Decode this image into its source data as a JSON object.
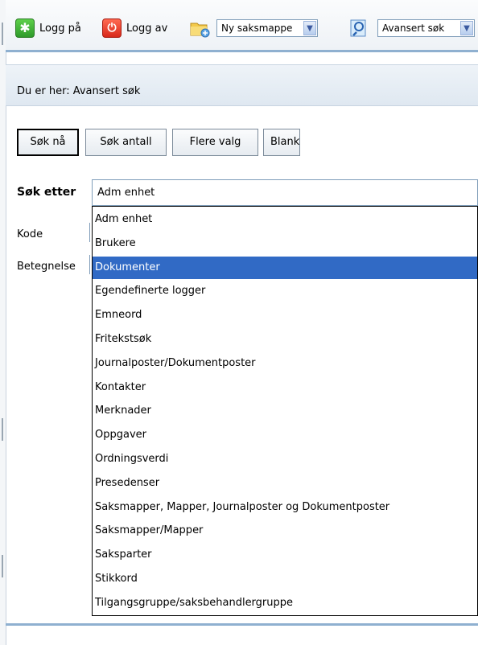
{
  "toolbar": {
    "logon_label": "Logg på",
    "logoff_label": "Logg av",
    "new_folder_select": "Ny saksmappe",
    "search_select": "Avansert søk"
  },
  "breadcrumb": {
    "text": "Du er her: Avansert søk"
  },
  "actions": {
    "search_now": "Søk nå",
    "search_count": "Søk antall",
    "more_options": "Flere valg",
    "blank": "Blank"
  },
  "form": {
    "search_for_label": "Søk etter",
    "search_for_value": "Adm enhet",
    "code_label": "Kode",
    "description_label": "Betegnelse"
  },
  "dropdown": {
    "selected_index": 2,
    "options": [
      "Adm enhet",
      "Brukere",
      "Dokumenter",
      "Egendefinerte logger",
      "Emneord",
      "Fritekstsøk",
      "Journalposter/Dokumentposter",
      "Kontakter",
      "Merknader",
      "Oppgaver",
      "Ordningsverdi",
      "Presedenser",
      "Saksmapper, Mapper, Journalposter og Dokumentposter",
      "Saksmapper/Mapper",
      "Saksparter",
      "Stikkord",
      "Tilgangsgruppe/saksbehandlergruppe"
    ]
  },
  "colors": {
    "highlight": "#316ac5",
    "toolbar_border": "#8fb0d0"
  }
}
